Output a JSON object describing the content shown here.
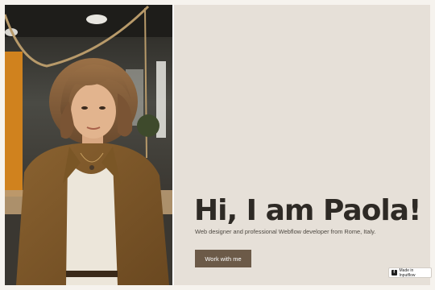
{
  "hero": {
    "image_alt": "Portrait of a woman with curly short hair in a brown shirt standing in an office",
    "headline": "Hi, I am Paola!",
    "subtitle": "Web designer and professional Webflow developer from Rome, Italy.",
    "cta_label": "Work with me"
  },
  "badge": {
    "icon": "f",
    "label": "Made in Inputflow"
  },
  "colors": {
    "panel": "#e6e0d8",
    "headline": "#2e2a25",
    "button": "#6c5a48"
  }
}
